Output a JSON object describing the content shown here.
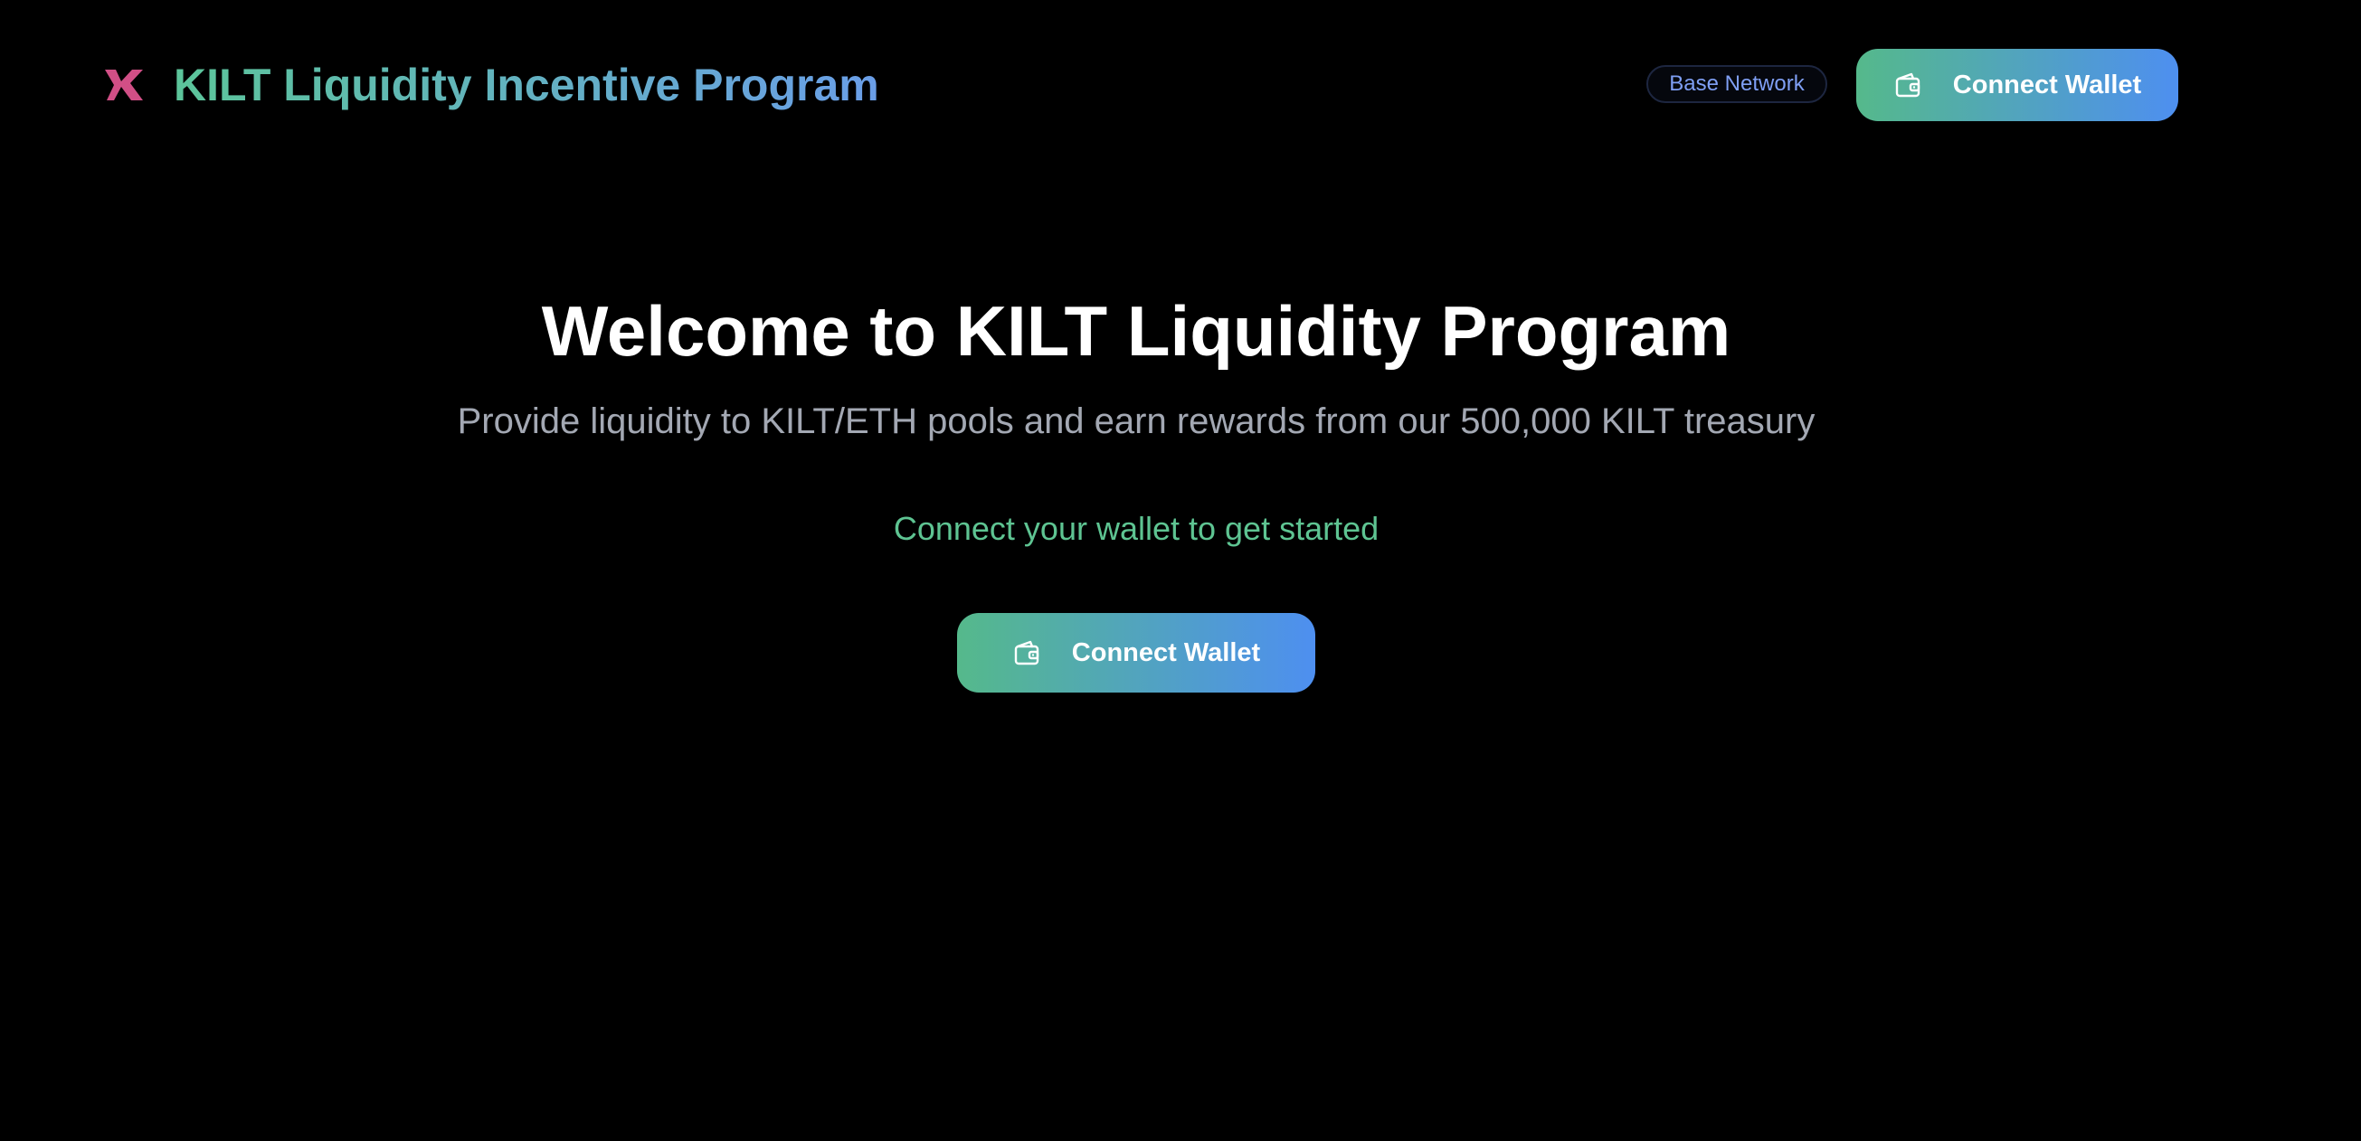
{
  "header": {
    "app_title": "KILT Liquidity Incentive Program",
    "logo_icon": "kilt-logo-icon",
    "network_badge": "Base Network",
    "connect_button_label": "Connect Wallet",
    "connect_button_icon": "wallet-icon"
  },
  "hero": {
    "title": "Welcome to KILT Liquidity Program",
    "subtitle": "Provide liquidity to KILT/ETH pools and earn rewards from our 500,000 KILT treasury",
    "cta_text": "Connect your wallet to get started",
    "connect_button_label": "Connect Wallet",
    "connect_button_icon": "wallet-icon"
  },
  "colors": {
    "background": "#000000",
    "accent_green": "#55b98b",
    "accent_blue": "#4e8ff0",
    "logo_pink": "#d14f86",
    "badge_text": "#7f9ff4",
    "subtitle_text": "#a3a8b3"
  }
}
